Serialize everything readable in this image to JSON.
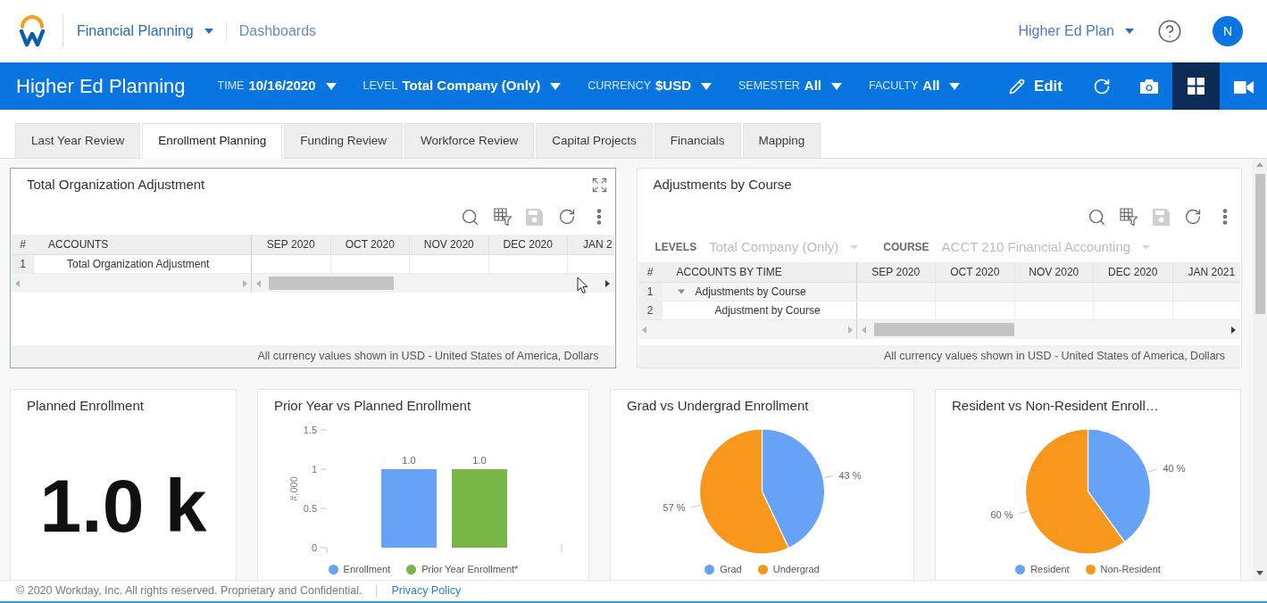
{
  "top_bar": {
    "app_menu": "Financial Planning",
    "breadcrumb": "Dashboards",
    "plan_menu": "Higher Ed Plan",
    "avatar_initial": "N"
  },
  "toolbar": {
    "title": "Higher Ed Planning",
    "filters": [
      {
        "label": "TIME",
        "value": "10/16/2020"
      },
      {
        "label": "LEVEL",
        "value": "Total Company (Only)"
      },
      {
        "label": "CURRENCY",
        "value": "$USD"
      },
      {
        "label": "SEMESTER",
        "value": "All"
      },
      {
        "label": "FACULTY",
        "value": "All"
      }
    ],
    "edit_button": "Edit",
    "view_buttons": [
      {
        "selected": true
      },
      {
        "selected": false
      }
    ]
  },
  "tabs": [
    {
      "label": "Last Year Review",
      "selected": false
    },
    {
      "label": "Enrollment Planning",
      "selected": true
    },
    {
      "label": "Funding Review",
      "selected": false
    },
    {
      "label": "Workforce Review",
      "selected": false
    },
    {
      "label": "Capital Projects",
      "selected": false
    },
    {
      "label": "Financials",
      "selected": false
    },
    {
      "label": "Mapping",
      "selected": false
    }
  ],
  "panels": [
    {
      "title": "Total Organization Adjustment",
      "focused": true,
      "tools": [
        {
          "disabled": false
        },
        {
          "disabled": false
        },
        {
          "disabled": true
        },
        {
          "disabled": false
        },
        {
          "disabled": false
        }
      ],
      "table": {
        "columns": [
          "#",
          "ACCOUNTS",
          "SEP 2020",
          "OCT 2020",
          "NOV 2020",
          "DEC 2020",
          "JAN 2"
        ],
        "rows": [
          {
            "number": "1",
            "label": "Total Organization Adjustment"
          }
        ]
      },
      "footnote": "All currency values shown in USD - United States of America, Dollars"
    },
    {
      "title": "Adjustments by Course",
      "focused": false,
      "tools": [
        {
          "disabled": false
        },
        {
          "disabled": false
        },
        {
          "disabled": true
        },
        {
          "disabled": false
        },
        {
          "disabled": false
        }
      ],
      "prompts": [
        {
          "label": "LEVELS",
          "value": "Total Company (Only)",
          "disabled": true
        },
        {
          "label": "COURSE",
          "value": "ACCT 210 Financial Accounting",
          "disabled": true
        }
      ],
      "table": {
        "columns": [
          "#",
          "ACCOUNTS BY TIME",
          "SEP 2020",
          "OCT 2020",
          "NOV 2020",
          "DEC 2020",
          "JAN 2021"
        ],
        "rows": [
          {
            "number": "1",
            "label": "Adjustments by Course",
            "expanded": true,
            "children": [
              {
                "number": "2",
                "label": "Adjustment by Course"
              }
            ]
          }
        ]
      },
      "footnote": "All currency values shown in USD - United States of America, Dollars"
    }
  ],
  "widgets": [
    {
      "kind": "kpi",
      "title": "Planned Enrollment",
      "value": "1.0 k"
    },
    {
      "kind": "chart",
      "chart_data": {
        "type": "bar",
        "title": "Prior Year vs Planned Enrollment",
        "ylabel": "#,000",
        "ylim": [
          0,
          1.5
        ],
        "yticks": [
          0,
          0.5,
          1,
          1.5
        ],
        "series": [
          {
            "name": "Enrollment",
            "color": "#66a3f7",
            "values": [
              1.0
            ]
          },
          {
            "name": "Prior Year Enrollment*",
            "color": "#7ab648",
            "values": [
              1.0
            ]
          }
        ],
        "value_labels": [
          "1.0",
          "1.0"
        ],
        "legend": "bottom"
      }
    },
    {
      "kind": "chart",
      "chart_data": {
        "type": "pie",
        "title": "Grad vs Undergrad Enrollment",
        "categories": [
          "Grad",
          "Undergrad"
        ],
        "values": [
          43,
          57
        ],
        "colors": [
          "#66a3f7",
          "#f7981d"
        ],
        "value_labels": [
          "43 %",
          "57 %"
        ],
        "legend": "bottom"
      }
    },
    {
      "kind": "chart",
      "chart_data": {
        "type": "pie",
        "title": "Resident vs Non-Resident Enroll…",
        "categories": [
          "Resident",
          "Non-Resident"
        ],
        "values": [
          40,
          60
        ],
        "colors": [
          "#66a3f7",
          "#f7981d"
        ],
        "value_labels": [
          "40 %",
          "60 %"
        ],
        "legend": "bottom"
      }
    }
  ],
  "footer": {
    "copyright": "© 2020 Workday, Inc. All rights reserved. Proprietary and Confidential.",
    "link": "Privacy Policy"
  }
}
